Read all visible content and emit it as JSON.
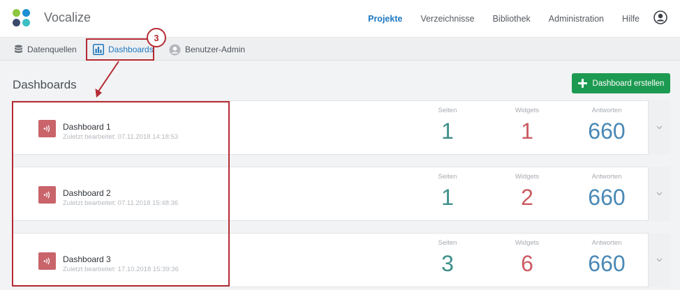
{
  "app": {
    "name": "Vocalize",
    "logo_colors": [
      "#8dc63f",
      "#1a8fd1",
      "#3b4a6b",
      "#3bbfc4"
    ]
  },
  "topnav": {
    "items": [
      {
        "label": "Projekte",
        "active": true
      },
      {
        "label": "Verzeichnisse",
        "active": false
      },
      {
        "label": "Bibliothek",
        "active": false
      },
      {
        "label": "Administration",
        "active": false
      },
      {
        "label": "Hilfe",
        "active": false
      }
    ],
    "user_icon": "user-circle-icon"
  },
  "subnav": {
    "items": [
      {
        "label": "Datenquellen",
        "icon": "database-icon",
        "active": false
      },
      {
        "label": "Dashboards",
        "icon": "bar-chart-icon",
        "active": true
      },
      {
        "label": "Benutzer-Admin",
        "icon": "user-icon",
        "active": false
      }
    ]
  },
  "annotation": {
    "number": "3",
    "color": "#b52a33"
  },
  "page": {
    "title": "Dashboards",
    "create_button": "Dashboard erstellen"
  },
  "metric_labels": {
    "pages": "Seiten",
    "widgets": "Widgets",
    "answers": "Antworten"
  },
  "dashboards": [
    {
      "name": "Dashboard 1",
      "edited": "Zuletzt bearbeitet: 07.11.2018 14:18:53",
      "pages": "1",
      "widgets": "1",
      "answers": "660"
    },
    {
      "name": "Dashboard 2",
      "edited": "Zuletzt bearbeitet: 07.11.2018 15:48:36",
      "pages": "1",
      "widgets": "2",
      "answers": "660"
    },
    {
      "name": "Dashboard 3",
      "edited": "Zuletzt bearbeitet: 17.10.2018 15:39:36",
      "pages": "3",
      "widgets": "6",
      "answers": "660"
    }
  ],
  "colors": {
    "accent": "#1d78c1",
    "create_button": "#1d9a51",
    "pages_value": "#3e8f8a",
    "widgets_value": "#cc5b63",
    "answers_value": "#4a88b6",
    "dashboard_icon": "#c9646a"
  }
}
